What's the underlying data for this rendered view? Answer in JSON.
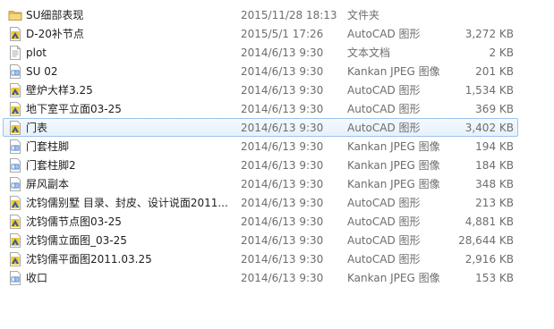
{
  "files": [
    {
      "name": "SU细部表现",
      "date": "2015/11/28 18:13",
      "type": "文件夹",
      "size": "",
      "icon": "folder-icon"
    },
    {
      "name": "D-20补节点",
      "date": "2015/5/1 17:26",
      "type": "AutoCAD 图形",
      "size": "3,272 KB",
      "icon": "autocad-file-icon"
    },
    {
      "name": "plot",
      "date": "2014/6/13 9:30",
      "type": "文本文档",
      "size": "2 KB",
      "icon": "text-file-icon"
    },
    {
      "name": "SU 02",
      "date": "2014/6/13 9:30",
      "type": "Kankan JPEG 图像",
      "size": "201 KB",
      "icon": "jpeg-file-icon"
    },
    {
      "name": "壁炉大样3.25",
      "date": "2014/6/13 9:30",
      "type": "AutoCAD 图形",
      "size": "1,534 KB",
      "icon": "autocad-file-icon"
    },
    {
      "name": "地下室平立面03-25",
      "date": "2014/6/13 9:30",
      "type": "AutoCAD 图形",
      "size": "369 KB",
      "icon": "autocad-file-icon"
    },
    {
      "name": "门表",
      "date": "2014/6/13 9:30",
      "type": "AutoCAD 图形",
      "size": "3,402 KB",
      "icon": "autocad-file-icon",
      "selected": true
    },
    {
      "name": "门套柱脚",
      "date": "2014/6/13 9:30",
      "type": "Kankan JPEG 图像",
      "size": "194 KB",
      "icon": "jpeg-file-icon"
    },
    {
      "name": "门套柱脚2",
      "date": "2014/6/13 9:30",
      "type": "Kankan JPEG 图像",
      "size": "184 KB",
      "icon": "jpeg-file-icon"
    },
    {
      "name": "屏风副本",
      "date": "2014/6/13 9:30",
      "type": "Kankan JPEG 图像",
      "size": "348 KB",
      "icon": "jpeg-file-icon"
    },
    {
      "name": "沈钧儒别墅  目录、封皮、设计说面2011...",
      "date": "2014/6/13 9:30",
      "type": "AutoCAD 图形",
      "size": "213 KB",
      "icon": "autocad-file-icon"
    },
    {
      "name": "沈钧儒节点图03-25",
      "date": "2014/6/13 9:30",
      "type": "AutoCAD 图形",
      "size": "4,881 KB",
      "icon": "autocad-file-icon"
    },
    {
      "name": "沈钧儒立面图_03-25",
      "date": "2014/6/13 9:30",
      "type": "AutoCAD 图形",
      "size": "28,644 KB",
      "icon": "autocad-file-icon"
    },
    {
      "name": "沈钧儒平面图2011.03.25",
      "date": "2014/6/13 9:30",
      "type": "AutoCAD 图形",
      "size": "2,916 KB",
      "icon": "autocad-file-icon"
    },
    {
      "name": "收口",
      "date": "2014/6/13 9:30",
      "type": "Kankan JPEG 图像",
      "size": "153 KB",
      "icon": "jpeg-file-icon"
    }
  ],
  "colors": {
    "folder": "#e8c15a",
    "autocad_yellow": "#f2c62f",
    "autocad_blue": "#2b5ea8",
    "jpeg_blue": "#3b7ed0",
    "selection_border": "#9cc3ea"
  }
}
